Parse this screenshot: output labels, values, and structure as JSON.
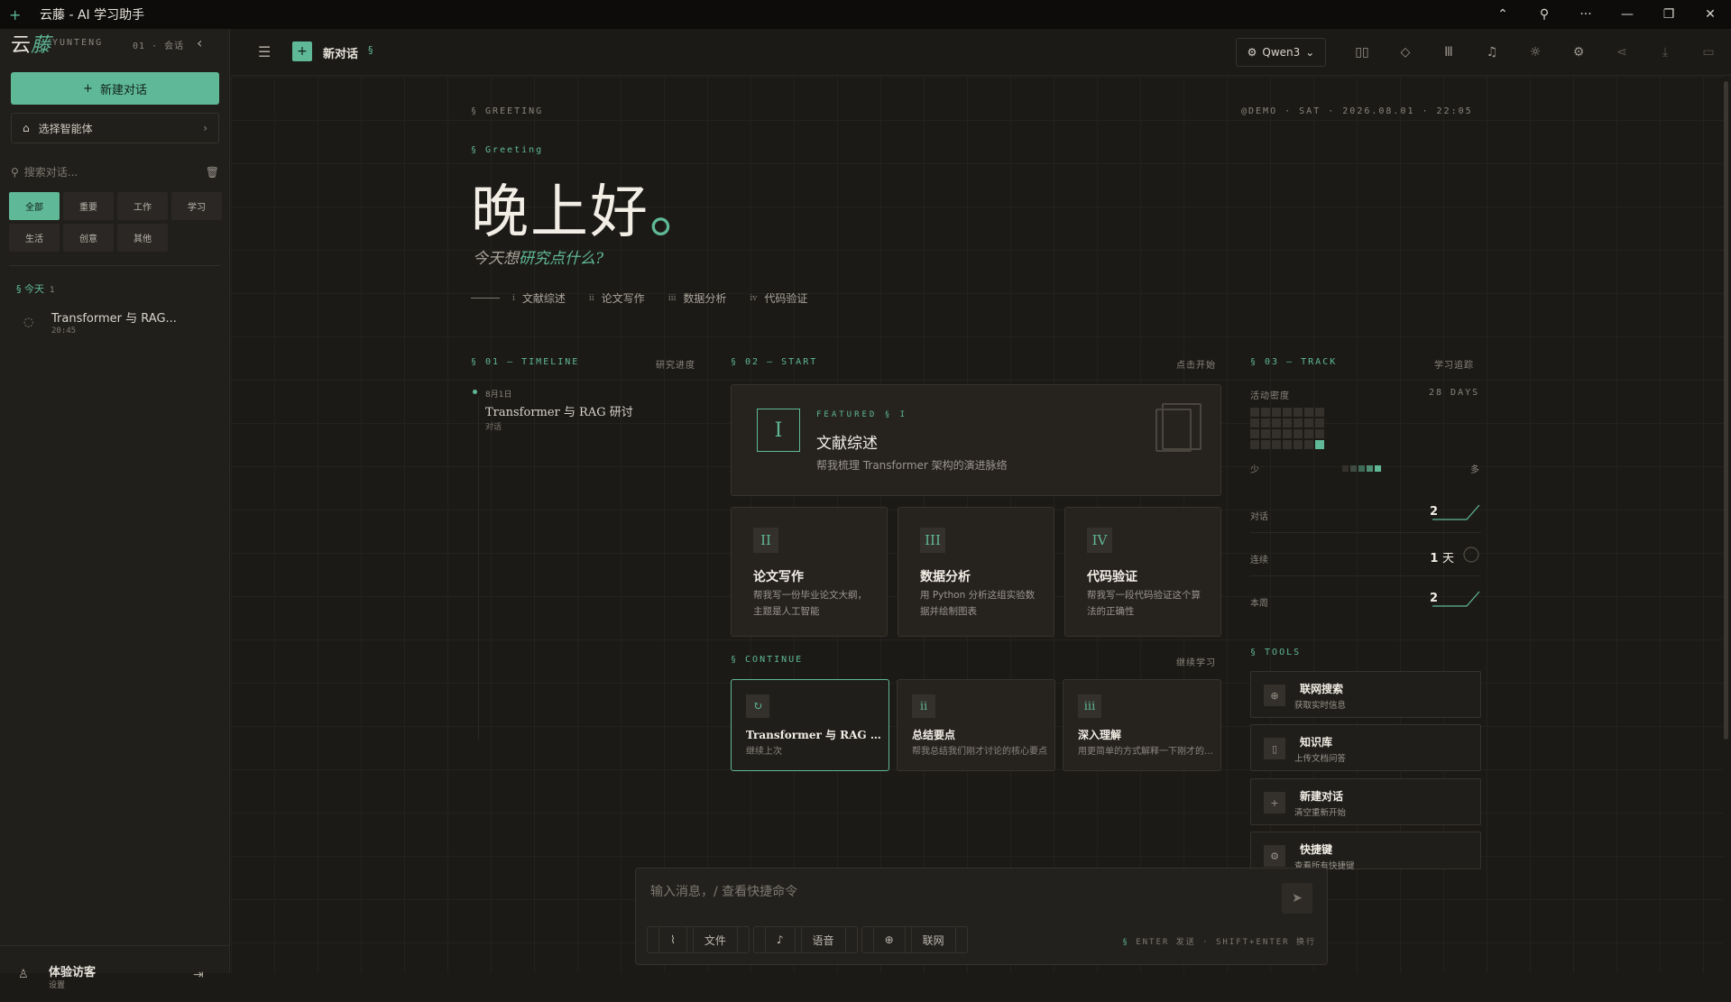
{
  "window": {
    "title": "云藤 - AI 学习助手",
    "controls": [
      "⌃",
      "⚲",
      "···",
      "—",
      "❐",
      "✕"
    ]
  },
  "sidebar": {
    "logo_main": "云",
    "logo_accent": "藤",
    "logo_sub": "YUNTENG",
    "logo_version": "01 · 会话",
    "new_chat_label": "新建对话",
    "agent_label": "选择智能体",
    "search_placeholder": "搜索对话...",
    "filters": [
      "全部",
      "重要",
      "工作",
      "学习",
      "生活",
      "创意",
      "其他"
    ],
    "today_label": "§ 今天",
    "today_count": "1",
    "conversation": {
      "title": "Transformer 与 RAG...",
      "time": "20:45"
    },
    "user_name": "体验访客",
    "user_status": "设置"
  },
  "topbar": {
    "title": "新对话",
    "section": "§",
    "model": "Qwen3"
  },
  "main": {
    "greeting_tag": "§ GREETING",
    "meta": "@DEMO · SAT · 2026.08.01 · 22:05",
    "greeting_sub_tag": "§ Greeting",
    "greeting_text": "晚上好",
    "greeting_dot": "。",
    "prompt_plain": "今天想",
    "prompt_highlight": "研究点什么?",
    "quick_links": [
      {
        "num": "i",
        "label": "文献综述"
      },
      {
        "num": "ii",
        "label": "论文写作"
      },
      {
        "num": "iii",
        "label": "数据分析"
      },
      {
        "num": "iv",
        "label": "代码验证"
      }
    ],
    "timeline": {
      "head": "§ 01 — TIMELINE",
      "head_right": "研究进度",
      "date": "8月1日",
      "title": "Transformer 与 RAG 研讨",
      "type": "对话"
    },
    "start": {
      "head": "§ 02 — START",
      "head_right": "点击开始",
      "featured": {
        "num": "I",
        "tag": "FEATURED § I",
        "title": "文献综述",
        "desc": "帮我梳理 Transformer 架构的演进脉络"
      },
      "cards": [
        {
          "num": "II",
          "title": "论文写作",
          "desc": "帮我写一份毕业论文大纲，主题是人工智能"
        },
        {
          "num": "III",
          "title": "数据分析",
          "desc": "用 Python 分析这组实验数据并绘制图表"
        },
        {
          "num": "IV",
          "title": "代码验证",
          "desc": "帮我写一段代码验证这个算法的正确性"
        }
      ]
    },
    "continue": {
      "head": "§ CONTINUE",
      "head_right": "继续学习",
      "cards": [
        {
          "icon": "↻",
          "title": "Transformer 与 RAG 研讨",
          "desc": "继续上次"
        },
        {
          "icon": "ii",
          "title": "总结要点",
          "desc": "帮我总结我们刚才讨论的核心要点"
        },
        {
          "icon": "iii",
          "title": "深入理解",
          "desc": "用更简单的方式解释一下刚才的内容"
        }
      ]
    },
    "track": {
      "head": "§ 03 — TRACK",
      "head_right": "学习追踪",
      "activity_label": "活动密度",
      "days_label": "28 DAYS",
      "activity_level": 1,
      "legend_less": "少",
      "legend_more": "多",
      "stats": [
        {
          "label": "对话",
          "value": "2"
        },
        {
          "label": "连续",
          "value": "1",
          "unit": "天"
        },
        {
          "label": "本周",
          "value": "2"
        }
      ]
    },
    "tools": {
      "head": "§ TOOLS",
      "items": [
        {
          "icon": "globe-icon",
          "title": "联网搜索",
          "desc": "获取实时信息"
        },
        {
          "icon": "book-icon",
          "title": "知识库",
          "desc": "上传文档问答"
        },
        {
          "icon": "plus-icon",
          "title": "新建对话",
          "desc": "清空重新开始"
        },
        {
          "icon": "keyboard-icon",
          "title": "快捷键",
          "desc": "查看所有快捷键"
        }
      ]
    }
  },
  "composer": {
    "placeholder": "输入消息，/ 查看快捷命令",
    "tools": [
      "文件",
      "语音",
      "联网"
    ],
    "hint_mark": "§",
    "hint": "ENTER 发送 · SHIFT+ENTER 换行"
  },
  "colors": {
    "accent": "#5fb898",
    "bg": "#1c1a17",
    "sidebar": "#211f1c",
    "card": "#26231f"
  }
}
